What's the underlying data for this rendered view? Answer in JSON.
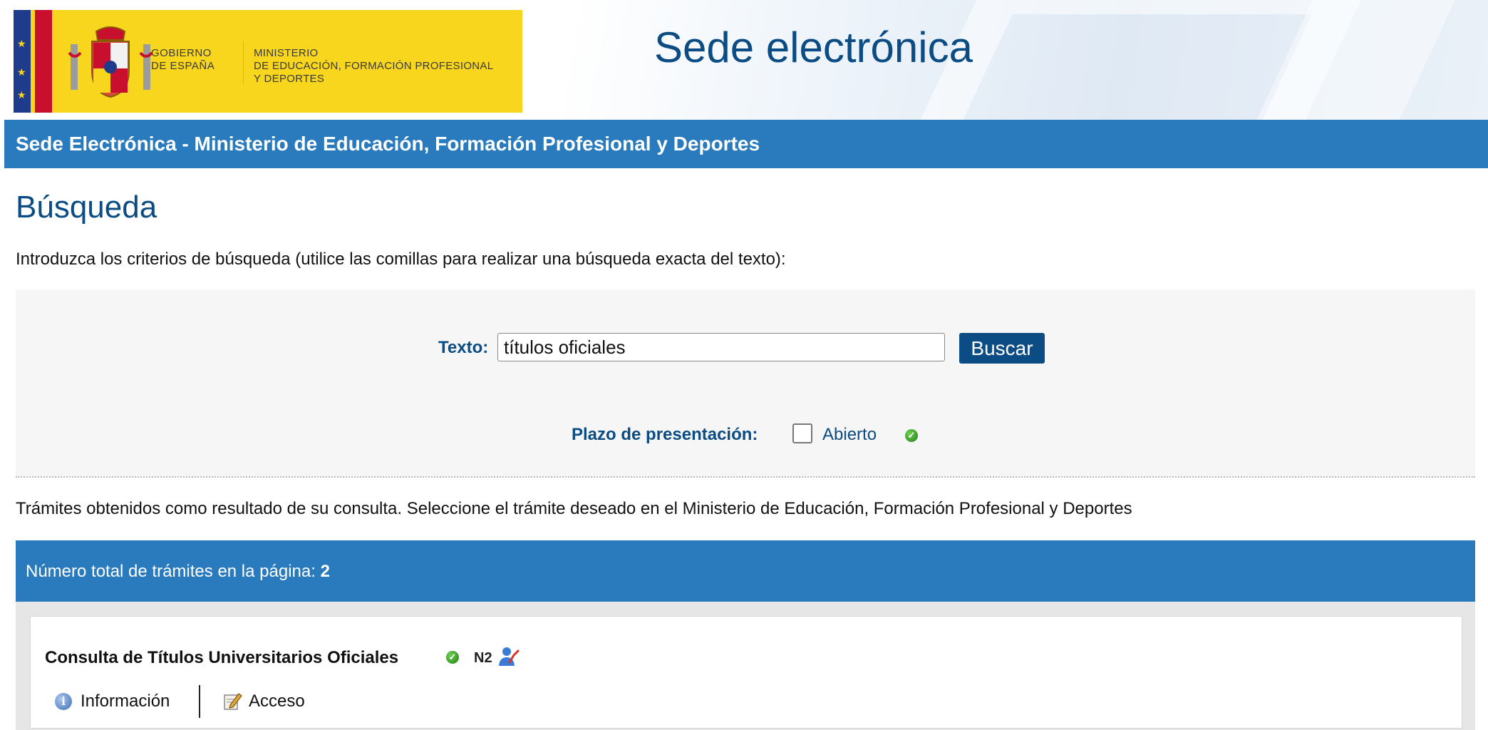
{
  "header": {
    "gobierno": [
      "GOBIERNO",
      "DE ESPAÑA"
    ],
    "ministerio": [
      "MINISTERIO",
      "DE EDUCACIÓN, FORMACIÓN PROFESIONAL",
      "Y DEPORTES"
    ],
    "site_title": "Sede electrónica"
  },
  "navbar": {
    "title": "Sede Electrónica - Ministerio de Educación, Formación Profesional y Deportes"
  },
  "page": {
    "title": "Búsqueda",
    "intro": "Introduzca los criterios de búsqueda (utilice las comillas para realizar una búsqueda exacta del texto):"
  },
  "search": {
    "text_label": "Texto:",
    "text_value": "títulos oficiales",
    "button_label": "Buscar",
    "plazo_label": "Plazo de presentación:",
    "abierto_label": "Abierto",
    "abierto_checked": false
  },
  "results": {
    "intro": "Trámites obtenidos como resultado de su consulta. Seleccione el trámite deseado en el Ministerio de Educación, Formación Profesional y Deportes",
    "total_label": "Número total de trámites en la página:",
    "total_value": "2",
    "items": [
      {
        "title": "Consulta de Títulos Universitarios Oficiales",
        "level": "N2",
        "info_label": "Información",
        "access_label": "Acceso"
      }
    ]
  },
  "colors": {
    "primary_blue": "#0b4c84",
    "bar_blue": "#2a7bbd",
    "logo_yellow": "#f8d61e",
    "check_green": "#2e8b22"
  },
  "icons": [
    "spain-flag-icon",
    "coat-of-arms-icon",
    "green-check-icon",
    "user-certificate-icon",
    "info-icon",
    "edit-icon"
  ]
}
